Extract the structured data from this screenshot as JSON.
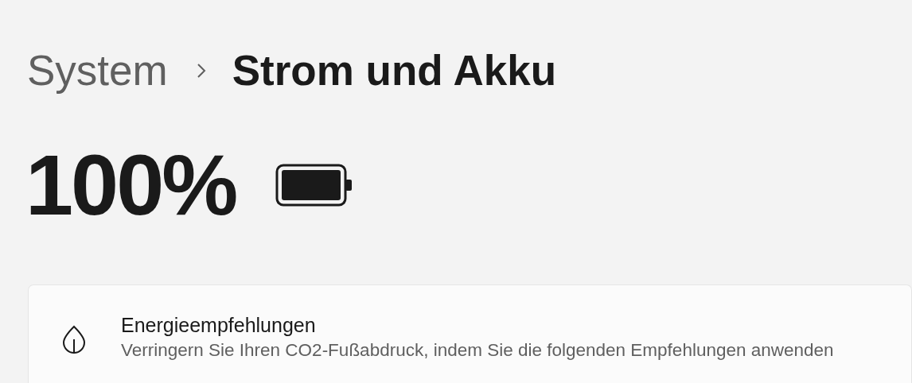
{
  "breadcrumb": [
    {
      "label": "System",
      "current": false
    },
    {
      "label": "Strom und Akku",
      "current": true
    }
  ],
  "battery": {
    "percentage": "100%"
  },
  "card": {
    "title": "Energieempfehlungen",
    "description": "Verringern Sie Ihren CO2-Fußabdruck, indem Sie die folgenden Empfehlungen anwenden"
  }
}
